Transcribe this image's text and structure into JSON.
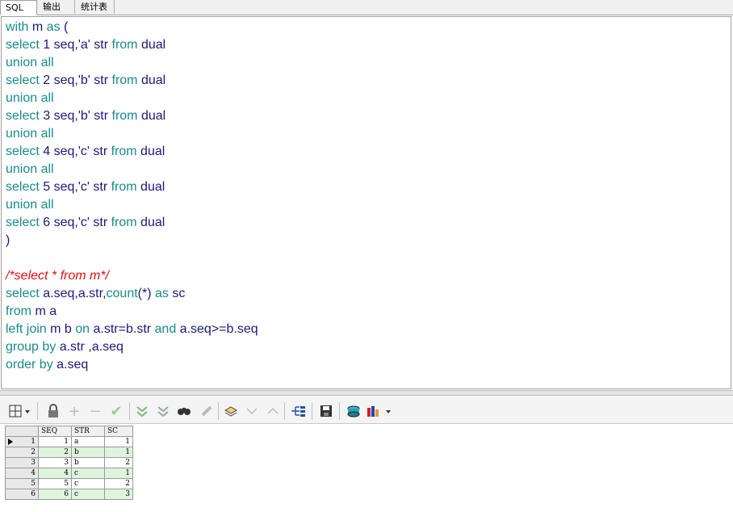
{
  "tabs": [
    {
      "label": "SQL",
      "active": true
    },
    {
      "label": "输出",
      "active": false
    },
    {
      "label": "统计表",
      "active": false
    }
  ],
  "editor": {
    "lines": [
      [
        {
          "t": "with",
          "c": "kw"
        },
        {
          "t": " m ",
          "c": "id"
        },
        {
          "t": "as",
          "c": "kw"
        },
        {
          "t": " (",
          "c": "id"
        }
      ],
      [
        {
          "t": "select",
          "c": "kw"
        },
        {
          "t": " 1 seq,'a' str ",
          "c": "id"
        },
        {
          "t": "from",
          "c": "kw"
        },
        {
          "t": " dual",
          "c": "id"
        }
      ],
      [
        {
          "t": "union all",
          "c": "kw"
        }
      ],
      [
        {
          "t": "select",
          "c": "kw"
        },
        {
          "t": " 2 seq,'b' str ",
          "c": "id"
        },
        {
          "t": "from",
          "c": "kw"
        },
        {
          "t": " dual",
          "c": "id"
        }
      ],
      [
        {
          "t": "union all",
          "c": "kw"
        }
      ],
      [
        {
          "t": "select",
          "c": "kw"
        },
        {
          "t": " 3 seq,'b' str ",
          "c": "id"
        },
        {
          "t": "from",
          "c": "kw"
        },
        {
          "t": " dual",
          "c": "id"
        }
      ],
      [
        {
          "t": "union all",
          "c": "kw"
        }
      ],
      [
        {
          "t": "select",
          "c": "kw"
        },
        {
          "t": " 4 seq,'c' str ",
          "c": "id"
        },
        {
          "t": "from",
          "c": "kw"
        },
        {
          "t": " dual",
          "c": "id"
        }
      ],
      [
        {
          "t": "union all",
          "c": "kw"
        }
      ],
      [
        {
          "t": "select",
          "c": "kw"
        },
        {
          "t": " 5 seq,'c' str ",
          "c": "id"
        },
        {
          "t": "from",
          "c": "kw"
        },
        {
          "t": " dual",
          "c": "id"
        }
      ],
      [
        {
          "t": "union all",
          "c": "kw"
        }
      ],
      [
        {
          "t": "select",
          "c": "kw"
        },
        {
          "t": " 6 seq,'c' str ",
          "c": "id"
        },
        {
          "t": "from",
          "c": "kw"
        },
        {
          "t": " dual",
          "c": "id"
        }
      ],
      [
        {
          "t": ")",
          "c": "id"
        }
      ],
      [],
      [
        {
          "t": "/*select * from m*/",
          "c": "cm"
        }
      ],
      [
        {
          "t": "select",
          "c": "kw"
        },
        {
          "t": " a.seq,a.str,",
          "c": "id"
        },
        {
          "t": "count",
          "c": "kw"
        },
        {
          "t": "(*) ",
          "c": "id"
        },
        {
          "t": "as",
          "c": "kw"
        },
        {
          "t": " sc",
          "c": "id"
        }
      ],
      [
        {
          "t": "from",
          "c": "kw"
        },
        {
          "t": " m a",
          "c": "id"
        }
      ],
      [
        {
          "t": "left join",
          "c": "kw"
        },
        {
          "t": " m b ",
          "c": "id"
        },
        {
          "t": "on",
          "c": "kw"
        },
        {
          "t": " a.str=b.str ",
          "c": "id"
        },
        {
          "t": "and",
          "c": "kw"
        },
        {
          "t": " a.seq>=b.seq",
          "c": "id"
        }
      ],
      [
        {
          "t": "group by",
          "c": "kw"
        },
        {
          "t": " a.str ,a.seq",
          "c": "id"
        }
      ],
      [
        {
          "t": "order by",
          "c": "kw"
        },
        {
          "t": " a.seq",
          "c": "id"
        }
      ]
    ]
  },
  "toolbar": {
    "icons": [
      "grid-view-icon",
      "lock-icon",
      "add-row-icon",
      "delete-row-icon",
      "post-icon",
      "filter-down-icon",
      "filter-clear-icon",
      "find-icon",
      "clear-icon",
      "query-by-example-icon",
      "previous-icon",
      "next-icon",
      "explain-icon",
      "save-icon",
      "export-icon",
      "chart-icon"
    ]
  },
  "grid": {
    "columns": [
      "SEQ",
      "STR",
      "SC"
    ],
    "rows": [
      {
        "n": "1",
        "seq": "1",
        "str": "a",
        "sc": "1"
      },
      {
        "n": "2",
        "seq": "2",
        "str": "b",
        "sc": "1"
      },
      {
        "n": "3",
        "seq": "3",
        "str": "b",
        "sc": "2"
      },
      {
        "n": "4",
        "seq": "4",
        "str": "c",
        "sc": "1"
      },
      {
        "n": "5",
        "seq": "5",
        "str": "c",
        "sc": "2"
      },
      {
        "n": "6",
        "seq": "6",
        "str": "c",
        "sc": "3"
      }
    ]
  }
}
